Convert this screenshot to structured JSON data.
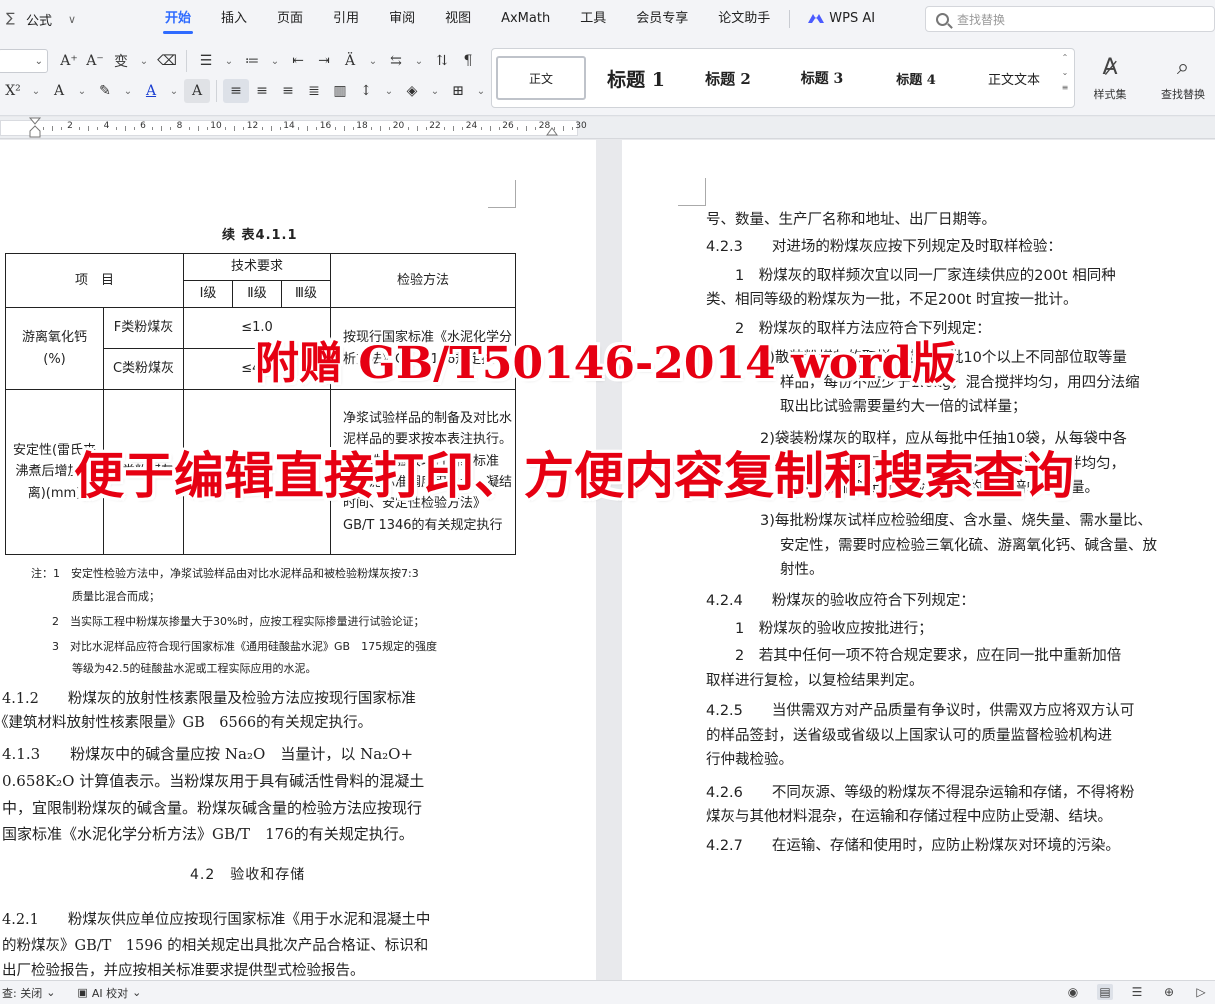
{
  "menubar": {
    "formula_label": "公式",
    "tabs": [
      "开始",
      "插入",
      "页面",
      "引用",
      "审阅",
      "视图",
      "AxMath",
      "工具",
      "会员专享",
      "论文助手"
    ],
    "active_tab": "开始",
    "wps_ai_label": "WPS AI",
    "search_placeholder": "查找替换"
  },
  "toolbar": {
    "styles": [
      "正文",
      "标题 1",
      "标题 2",
      "标题 3",
      "标题 4",
      "正文文本"
    ],
    "style_set_label": "样式集",
    "find_replace_label": "查找替换"
  },
  "ruler": {
    "labels": [
      "2",
      "4",
      "6",
      "8",
      "10",
      "12",
      "14",
      "16",
      "18",
      "20",
      "22",
      "24",
      "26",
      "28",
      "30"
    ]
  },
  "left_page": {
    "table_caption": "续 表4.1.1",
    "table": {
      "col_item": "项　目",
      "col_tech": "技术要求",
      "grade1": "I级",
      "grade2": "Ⅱ级",
      "grade3": "Ⅲ级",
      "col_method": "检验方法",
      "row1_name": "游离氧化钙\n(%)",
      "row1_f": "F类粉煤灰",
      "row1_f_val": "≤1.0",
      "row1_c": "C类粉煤灰",
      "row1_c_val": "≤4.0",
      "row1_method": "按现行国家标准《水泥化学分析方法》GB/T 176规定执行",
      "row2_name": "安定性(雷氏夹沸煮后增加距离)(mm)",
      "row2_c": "C类粉煤灰",
      "row2_val": "≤5.0",
      "row2_method": "净浆试验样品的制备及对比水泥样品的要求按本表注执行。安定性试验按现行国家标准《水泥标准稠度用水量、凝结时间、安定性检验方法》GB/T 1346的有关规定执行"
    },
    "notes": [
      "注：1　安定性检验方法中，净浆试验样品由对比水泥样品和被检验粉煤灰按7:3",
      "质量比混合而成；",
      "2　当实际工程中粉煤灰掺量大于30%时，应按工程实际掺量进行试验论证；",
      "3　对比水泥样品应符合现行国家标准《通用硅酸盐水泥》GB　175规定的强度",
      "等级为42.5的硅酸盐水泥或工程实际应用的水泥。"
    ],
    "paras": [
      "4.1.2　　粉煤灰的放射性核素限量及检验方法应按现行国家标准",
      "《建筑材料放射性核素限量》GB　6566的有关规定执行。",
      "4.1.3　　粉煤灰中的碱含量应按 Na₂O　当量计，以 Na₂O+",
      "0.658K₂O 计算值表示。当粉煤灰用于具有碱活性骨料的混凝土",
      "中，宜限制粉煤灰的碱含量。粉煤灰碱含量的检验方法应按现行",
      "国家标准《水泥化学分析方法》GB/T　176的有关规定执行。"
    ],
    "section_heading": "4.2　验收和存储",
    "paras2": [
      "4.2.1　　粉煤灰供应单位应按现行国家标准《用于水泥和混凝土中",
      "的粉煤灰》GB/T　1596 的相关规定出具批次产品合格证、标识和",
      "出厂检验报告，并应按相关标准要求提供型式检验报告。"
    ]
  },
  "right_page": {
    "lines": [
      "号、数量、生产厂名称和地址、出厂日期等。",
      "4.2.3　　对进场的粉煤灰应按下列规定及时取样检验：",
      "　　1　粉煤灰的取样频次宜以同一厂家连续供应的200t 相同种",
      "类、相同等级的粉煤灰为一批，不足200t 时宜按一批计。",
      "　　2　粉煤灰的取样方法应符合下列规定：",
      "1)散装粉煤灰的取样，应从每批10个以上不同部位取等量",
      "样品，每份不应少于1.0kg，混合搅拌均匀，用四分法缩",
      "取出比试验需要量约大一倍的试样量；",
      "2)袋装粉煤灰的取样，应从每批中任抽10袋，从每袋中各",
      "取样品不应少于1.0kg，按上款的方法混合搅拌均匀，",
      "用四分法缩取出比试验需要量约大一倍的试样量。",
      "3)每批粉煤灰试样应检验细度、含水量、烧失量、需水量比、",
      "安定性，需要时应检验三氧化硫、游离氧化钙、碱含量、放",
      "射性。",
      "4.2.4　　粉煤灰的验收应符合下列规定：",
      "　　1　粉煤灰的验收应按批进行；",
      "　　2　若其中任何一项不符合规定要求，应在同一批中重新加倍",
      "取样进行复检，以复检结果判定。",
      "4.2.5　　当供需双方对产品质量有争议时，供需双方应将双方认可",
      "的样品签封，送省级或省级以上国家认可的质量监督检验机构进",
      "行仲裁检验。",
      "4.2.6　　不同灰源、等级的粉煤灰不得混杂运输和存储，不得将粉",
      "煤灰与其他材料混杂，在运输和存储过程中应防止受潮、结块。",
      "4.2.7　　在运输、存储和使用时，应防止粉煤灰对环境的污染。"
    ]
  },
  "overlay": {
    "line1": "附赠 GB/T50146-2014 word版",
    "line2": "便于编辑直接打印、方便内容复制和搜索查询"
  },
  "statusbar": {
    "proof_label": "查: 关闭",
    "ai_proof_label": "AI 校对"
  }
}
